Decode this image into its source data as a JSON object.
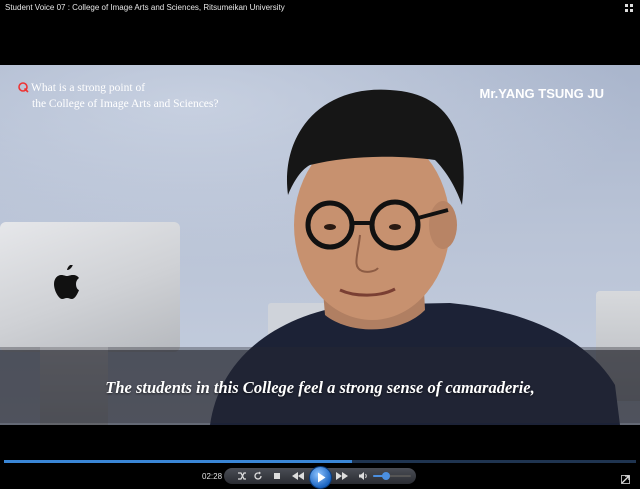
{
  "window": {
    "title": "Student Voice 07 : College of Image Arts and Sciences, Ritsumeikan University",
    "menu_icon": "grid-icon"
  },
  "video": {
    "speaker_name": "Mr.YANG TSUNG JU",
    "question_line1": "What is a strong point of",
    "question_line2": "the College of Image Arts and Sciences?",
    "question_icon": "q-icon",
    "subtitle": "The students in this College feel a strong sense of camaraderie,"
  },
  "player": {
    "current_time": "02:28",
    "progress": 0.55,
    "volume": 0.35,
    "accent_color": "#3a86d6",
    "buttons": [
      "shuffle-icon",
      "repeat-icon",
      "stop-icon",
      "rewind-icon",
      "play-icon",
      "fast-forward-icon",
      "volume-icon",
      "fullscreen-icon"
    ]
  }
}
